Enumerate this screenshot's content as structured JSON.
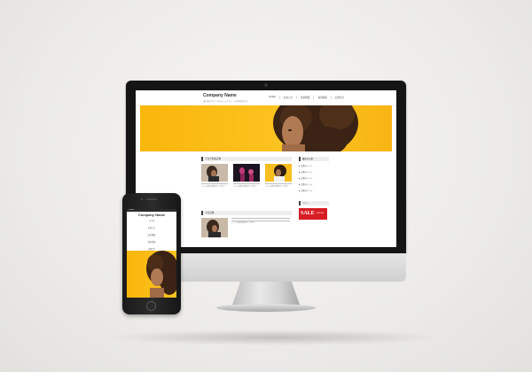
{
  "desktop_site": {
    "logo": "Company Name",
    "tagline": "会社名やサイトのキャッチフレーズを書きます。",
    "nav": [
      "HOME",
      "お知らせ",
      "会社概要",
      "採用情報",
      "お問合せ"
    ],
    "section1_title": "ブログ新着記事",
    "cards": [
      {
        "text": "ここに記事の抜粋が入ります。"
      },
      {
        "text": "ここに記事の抜粋が入ります。"
      },
      {
        "text": "ここに記事の抜粋が入ります。"
      }
    ],
    "section2_title": "人気記事",
    "feature_text": "ここに記事の抜粋が入ります。",
    "sidebar_title": "最新の記事",
    "sidebar_links": [
      "記事タイトル",
      "記事タイトル",
      "記事タイトル",
      "記事タイトル",
      "記事タイトル"
    ],
    "sidebar_title2": "バナー",
    "sale_banner": {
      "label": "SALE",
      "sub": "SPECIAL"
    }
  },
  "mobile_site": {
    "status": "Carrier",
    "logo": "Company Name",
    "nav": [
      "HOME",
      "お知らせ",
      "会社概要",
      "採用情報",
      "お問合せ"
    ]
  },
  "colors": {
    "hero_yellow": "#fcc321",
    "sale_red": "#d61d25",
    "device_black": "#151515"
  }
}
